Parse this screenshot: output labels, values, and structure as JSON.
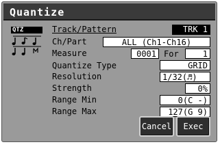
{
  "dialog": {
    "title": "Quantize",
    "mode_tag": "QTZ"
  },
  "fields": {
    "track_pattern": {
      "label": "Track/Pattern",
      "value": "TRK 1"
    },
    "ch_part": {
      "label": "Ch/Part",
      "value": "ALL (Ch1-Ch16)"
    },
    "measure": {
      "label": "Measure",
      "value": "0001",
      "for_label": "For",
      "for_value": "1"
    },
    "quantize_type": {
      "label": "Quantize Type",
      "value": "GRID"
    },
    "resolution": {
      "label": "Resolution",
      "value": "1/32(♬)"
    },
    "strength": {
      "label": "Strength",
      "value": "0%"
    },
    "range_min": {
      "label": "Range Min",
      "value": "0(C -)"
    },
    "range_max": {
      "label": "Range Max",
      "value": "127(G 9)"
    }
  },
  "buttons": {
    "cancel": "Cancel",
    "exec": "Exec"
  },
  "icons": {
    "mode_icon": "music-notes-icon"
  },
  "colors": {
    "dialog_bg": "#9a9a9a",
    "titlebar_bg": "#3a3a3a",
    "button_bg": "#2e2e2e"
  }
}
